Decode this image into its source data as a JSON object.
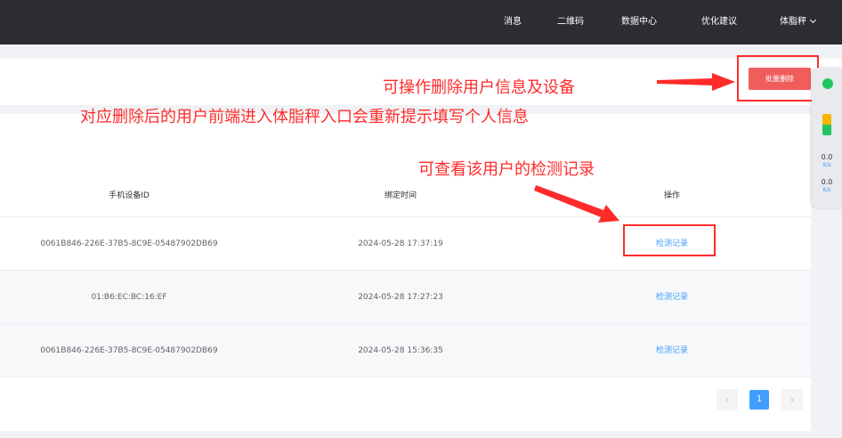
{
  "nav": {
    "items": [
      "消息",
      "二维码",
      "数据中心",
      "优化建议",
      "体脂秤"
    ]
  },
  "toolbar": {
    "bulk_delete_label": "批量删除"
  },
  "annotations": {
    "delete_note": "可操作删除用户信息及设备",
    "reentry_note": "对应删除后的用户前端进入体脂秤入口会重新提示填写个人信息",
    "record_note": "可查看该用户的检测记录"
  },
  "table": {
    "columns": [
      "手机设备ID",
      "绑定时间",
      "操作"
    ],
    "rows": [
      {
        "device_id": "0061B846-226E-37B5-8C9E-05487902DB69",
        "bind_time": "2024-05-28 17:37:19",
        "action": "检测记录"
      },
      {
        "device_id": "01:B6:EC:BC:16:EF",
        "bind_time": "2024-05-28 17:27:23",
        "action": "检测记录"
      },
      {
        "device_id": "0061B846-226E-37B5-8C9E-05487902DB69",
        "bind_time": "2024-05-28 15:36:35",
        "action": "检测记录"
      }
    ]
  },
  "pagination": {
    "prev": "‹",
    "current": "1",
    "next": "›"
  },
  "side_widget": {
    "upload": "0.0",
    "upload_unit": "K/s",
    "download": "0.0",
    "download_unit": "K/s"
  },
  "colors": {
    "topbar": "#2b2d31",
    "danger": "#f05d5d",
    "link": "#409eff",
    "annotation": "#ff2b2b"
  }
}
